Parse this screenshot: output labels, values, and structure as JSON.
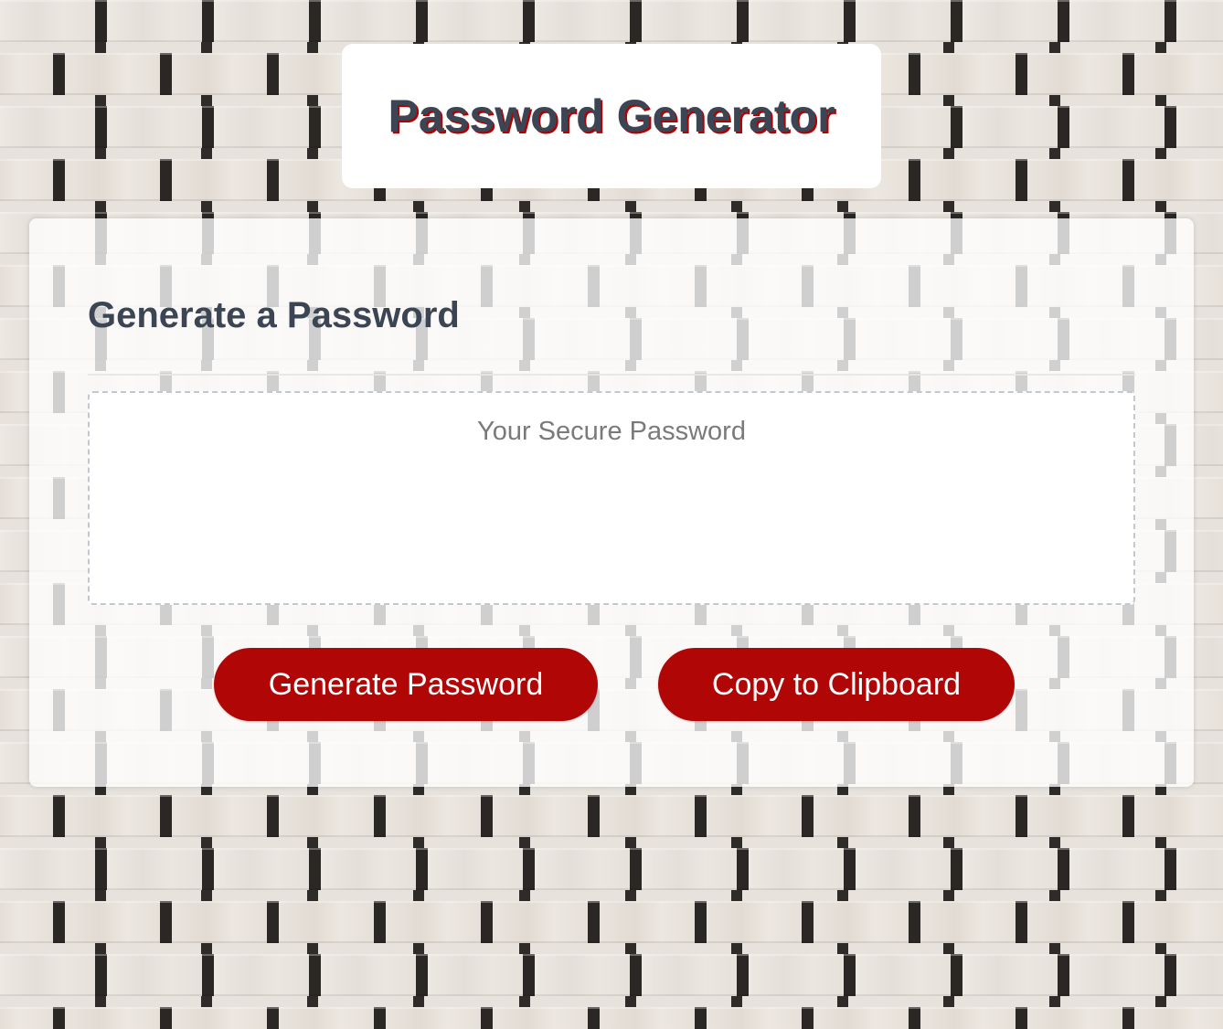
{
  "header": {
    "title": "Password Generator"
  },
  "card": {
    "heading": "Generate a Password",
    "password_field": {
      "value": "",
      "placeholder": "Your Secure Password"
    },
    "buttons": {
      "generate_label": "Generate Password",
      "copy_label": "Copy to Clipboard"
    }
  },
  "colors": {
    "accent": "#b10606",
    "heading": "#3b4553",
    "title_shadow": "#b30000"
  }
}
